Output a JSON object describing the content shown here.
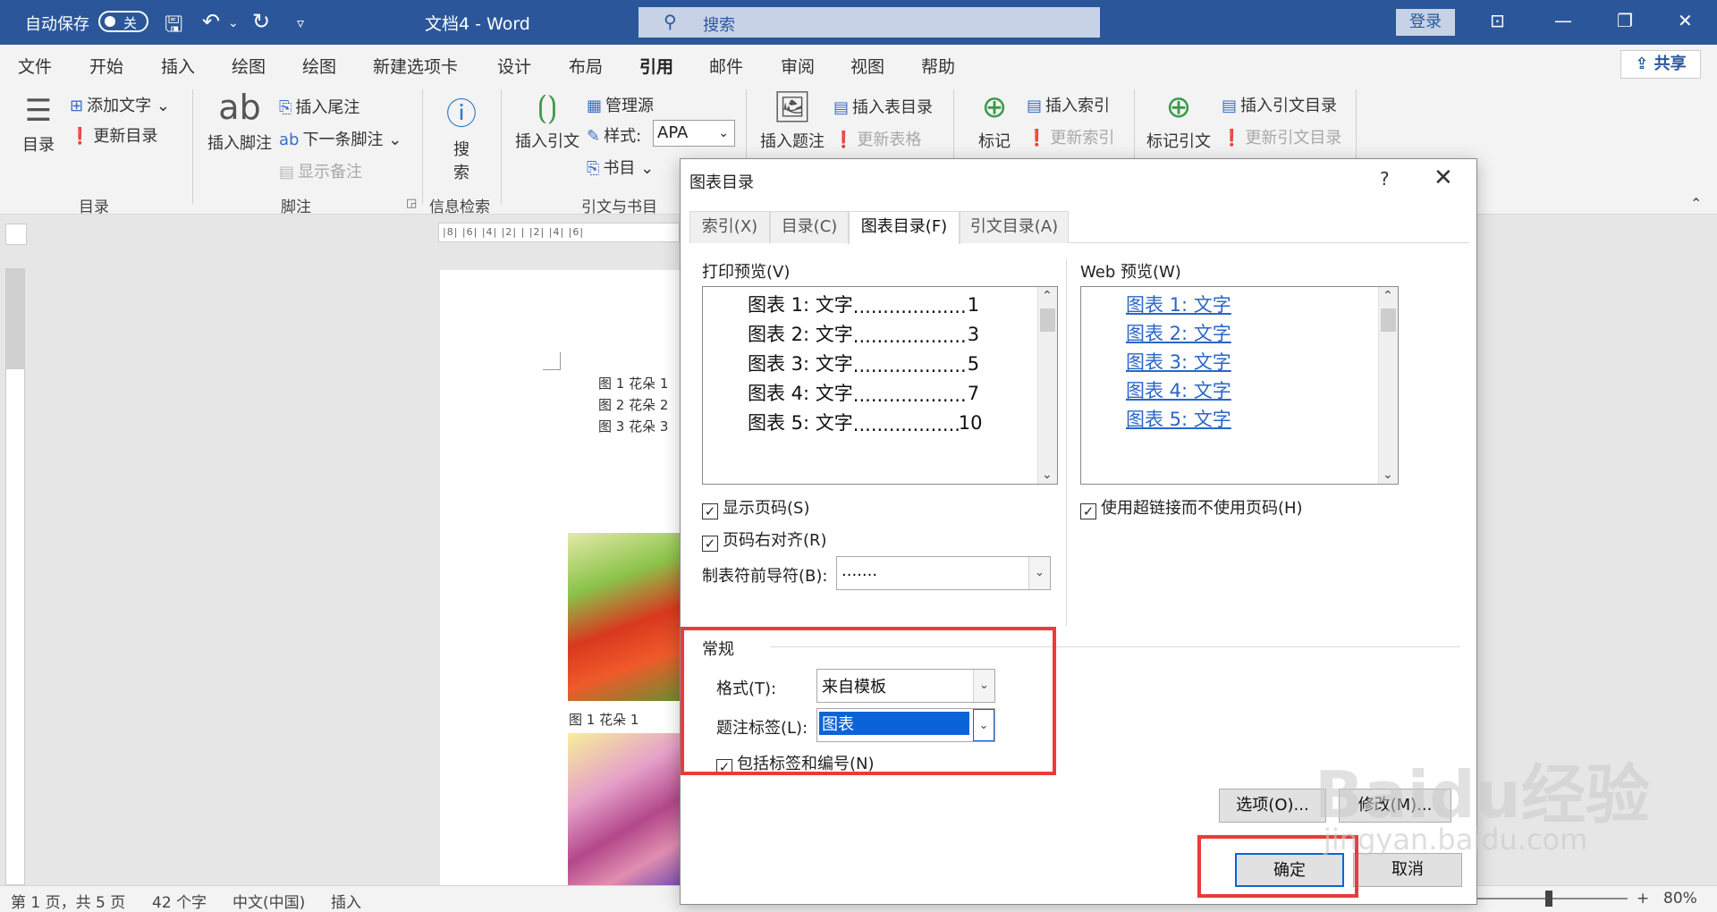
{
  "titlebar": {
    "autosave_label": "自动保存",
    "autosave_state": "关",
    "document_title": "文档4  -  Word",
    "search_placeholder": "搜索",
    "login_label": "登录"
  },
  "menu_tabs": [
    "文件",
    "开始",
    "插入",
    "绘图",
    "绘图",
    "新建选项卡",
    "设计",
    "布局",
    "引用",
    "邮件",
    "审阅",
    "视图",
    "帮助"
  ],
  "active_menu_tab": "引用",
  "share_label": "共享",
  "ribbon": {
    "toc_group": {
      "label": "目录",
      "big": "目录",
      "add_text": "添加文字",
      "update_toc": "更新目录"
    },
    "footnote_group": {
      "label": "脚注",
      "big": "插入脚注",
      "insert_endnote": "插入尾注",
      "next_footnote": "下一条脚注",
      "show_notes": "显示备注"
    },
    "research_group": {
      "label": "信息检索",
      "big_line1": "搜",
      "big_line2": "索"
    },
    "citation_group": {
      "label": "引文与书目",
      "big": "插入引文",
      "manage_sources": "管理源",
      "style_label": "样式:",
      "style_value": "APA",
      "bibliography": "书目"
    },
    "caption_group": {
      "big": "插入题注",
      "insert_table_of_figures": "插入表目录",
      "update_table": "更新表格"
    },
    "index_group": {
      "big": "标记",
      "insert_index": "插入索引",
      "update_index": "更新索引"
    },
    "toa_group": {
      "big": "标记引文",
      "insert_toa": "插入引文目录",
      "update_toa": "更新引文目录"
    }
  },
  "ruler_text": "|8|  |6|  |4|  |2|  |  |2|  |4|  |6|",
  "document": {
    "toc_lines": [
      "图 1 花朵 1",
      "图 2 花朵 2",
      "图 3 花朵 3"
    ],
    "caption1": "图 1 花朵 1"
  },
  "statusbar": {
    "page": "第 1 页，共 5 页",
    "words": "42 个字",
    "language": "中文(中国)",
    "mode": "插入",
    "zoom": "80%"
  },
  "dialog": {
    "title": "图表目录",
    "help": "?",
    "tabs": [
      "索引(X)",
      "目录(C)",
      "图表目录(F)",
      "引文目录(A)"
    ],
    "active_tab": "图表目录(F)",
    "print_preview_label": "打印预览(V)",
    "web_preview_label": "Web 预览(W)",
    "print_rows": [
      {
        "label": "图表  1:  文字",
        "page": "1"
      },
      {
        "label": "图表  2:  文字",
        "page": "3"
      },
      {
        "label": "图表  3:  文字",
        "page": "5"
      },
      {
        "label": "图表  4:  文字",
        "page": "7"
      },
      {
        "label": "图表  5:  文字",
        "page": "10"
      }
    ],
    "web_rows": [
      "图表  1:  文字",
      "图表  2:  文字",
      "图表  3:  文字",
      "图表  4:  文字",
      "图表  5:  文字"
    ],
    "show_page_numbers": {
      "label": "显示页码(S)",
      "checked": true
    },
    "right_align": {
      "label": "页码右对齐(R)",
      "checked": true
    },
    "use_hyperlinks": {
      "label": "使用超链接而不使用页码(H)",
      "checked": true
    },
    "tab_leader_label": "制表符前导符(B):",
    "tab_leader_value": ".......",
    "general_label": "常规",
    "format_label": "格式(T):",
    "format_value": "来自模板",
    "caption_label_label": "题注标签(L):",
    "caption_label_value": "图表",
    "include_label": {
      "label": "包括标签和编号(N)",
      "checked": true
    },
    "options_button": "选项(O)...",
    "modify_button": "修改(M)...",
    "ok_button": "确定",
    "cancel_button": "取消"
  },
  "watermark": {
    "text": "Baidu经验",
    "sub": "jingyan.baidu.com"
  },
  "colors": {
    "word_blue": "#2b579a",
    "highlight_red": "#ea3b3b",
    "selection": "#0a64d8"
  }
}
